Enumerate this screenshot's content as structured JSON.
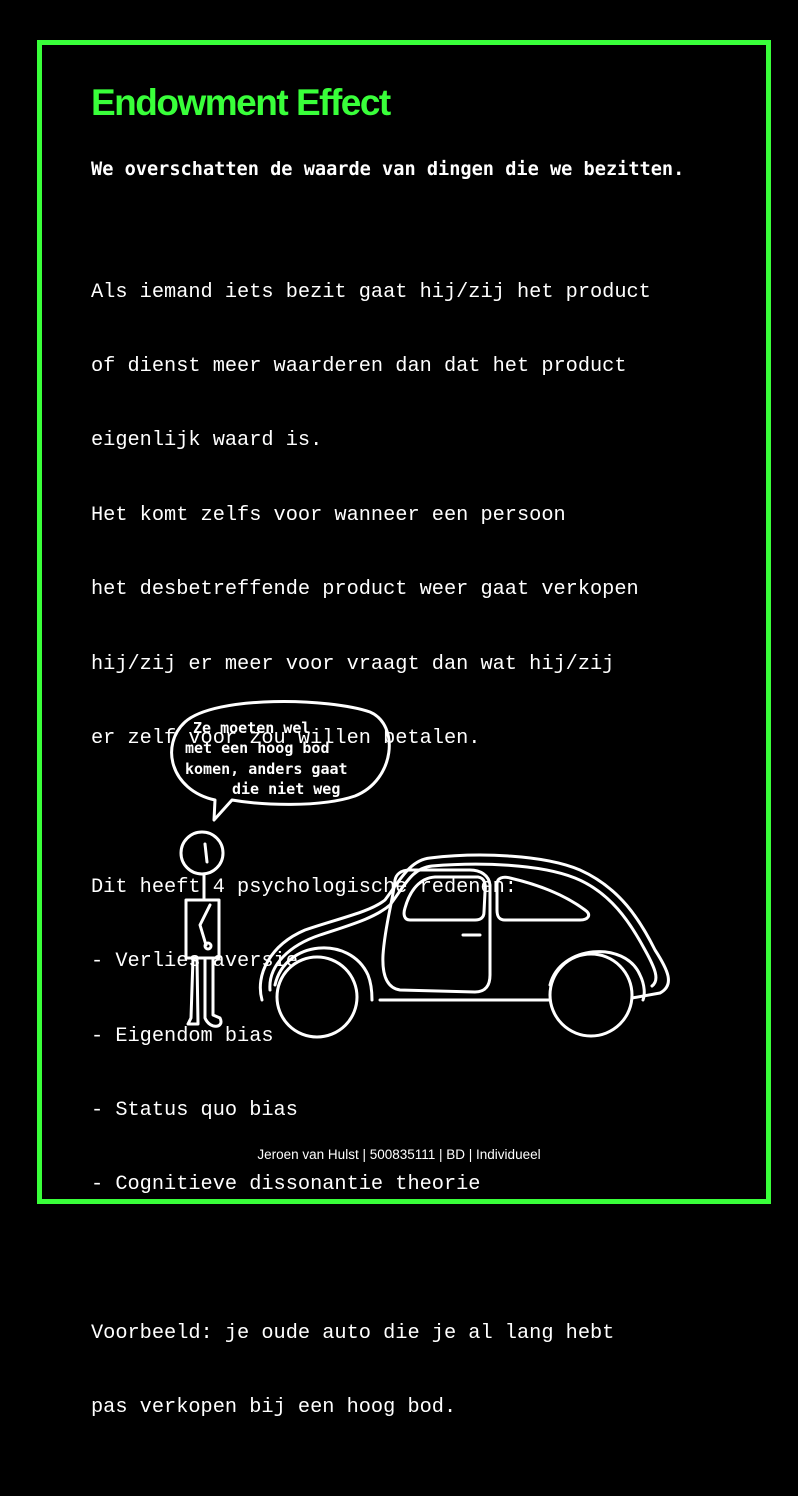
{
  "colors": {
    "accent": "#39ff3a",
    "background": "#000000",
    "text": "#ffffff"
  },
  "title": "Endowment Effect",
  "subtitle": "We overschatten de waarde van dingen die we bezitten.",
  "paragraphs": [
    [
      "Als iemand iets bezit gaat hij/zij het product",
      "of dienst meer waarderen dan dat het product",
      "eigenlijk waard is.",
      "Het komt zelfs voor wanneer een persoon",
      "het desbetreffende product weer gaat verkopen",
      "hij/zij er meer voor vraagt dan wat hij/zij",
      "er zelf voor zou willen betalen."
    ],
    [
      "Dit heeft 4 psychologische redenen:",
      "- Verlies aversie",
      "- Eigendom bias",
      "- Status quo bias",
      "- Cognitieve dissonantie theorie"
    ],
    [
      "Voorbeeld: je oude auto die je al lang hebt",
      "pas verkopen bij een hoog bod."
    ]
  ],
  "illustration": {
    "speech_bubble": [
      "Ze moeten wel",
      "met een hoog bod",
      "komen, anders gaat",
      "die niet weg"
    ],
    "icons": [
      "stick-figure-icon",
      "car-icon",
      "speech-bubble-icon"
    ]
  },
  "footer": "Jeroen van Hulst | 500835111 | BD | Individueel"
}
